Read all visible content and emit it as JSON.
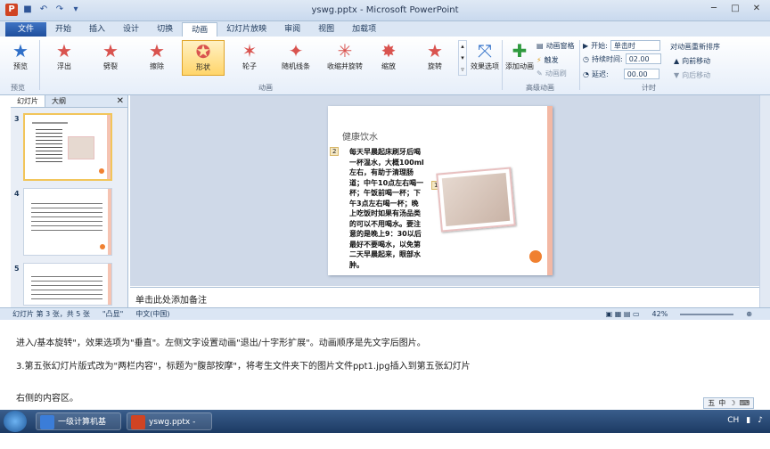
{
  "window": {
    "title": "yswg.pptx - Microsoft PowerPoint"
  },
  "tabs": [
    "文件",
    "开始",
    "插入",
    "设计",
    "切换",
    "动画",
    "幻灯片放映",
    "审阅",
    "视图",
    "加载项"
  ],
  "ribbon": {
    "preview_label": "预览",
    "preview_group": "预览",
    "animations": [
      "浮出",
      "劈裂",
      "擦除",
      "形状",
      "轮子",
      "随机线条",
      "收缩并旋转",
      "缩放",
      "旋转"
    ],
    "selected_animation": "形状",
    "effect_options": "效果选项",
    "animation_group": "动画",
    "add_animation": "添加动画",
    "animation_pane": "动画窗格",
    "trigger": "触发",
    "animation_painter": "动画刷",
    "advanced_group": "高级动画",
    "start_label": "开始:",
    "start_value": "单击时",
    "duration_label": "持续时间:",
    "duration_value": "02.00",
    "delay_label": "延迟:",
    "delay_value": "00.00",
    "timing_group": "计时",
    "reorder_label": "对动画重新排序",
    "move_earlier": "向前移动",
    "move_later": "向后移动"
  },
  "left_panel": {
    "tab_slides": "幻灯片",
    "tab_outline": "大纲",
    "slide_numbers": [
      "3",
      "4",
      "5"
    ]
  },
  "slide": {
    "title": "健康饮水",
    "body": "每天早晨起床刷牙后喝一杯温水，大概100ml左右，有助于清理肠道；中午10点左右喝一杯；午饭前喝一杯；下午3点左右喝一杯；晚上吃饭时如果有汤品类的可以不用喝水。要注意的是晚上9：30以后最好不要喝水，以免第二天早晨起来，眼部水肿。",
    "tag_text": "2",
    "tag_image": "1"
  },
  "notes": {
    "placeholder": "单击此处添加备注"
  },
  "status": {
    "slide_info": "幻灯片 第 3 张，共 5 张",
    "theme": "\"凸显\"",
    "language": "中文(中国)",
    "zoom": "42%"
  },
  "document": {
    "line1": "进入/基本旋转\"，效果选项为\"垂直\"。左侧文字设置动画\"退出/十字形扩展\"。动画顺序是先文字后图片。",
    "line2": "3.第五张幻灯片版式改为\"两栏内容\"，标题为\"腹部按摩\"，将考生文件夹下的图片文件ppt1.jpg插入到第五张幻灯片",
    "line3": "右侧的内容区。"
  },
  "taskbar": {
    "item1": "一级计算机基础...",
    "item2": "yswg.pptx - Mic..."
  }
}
